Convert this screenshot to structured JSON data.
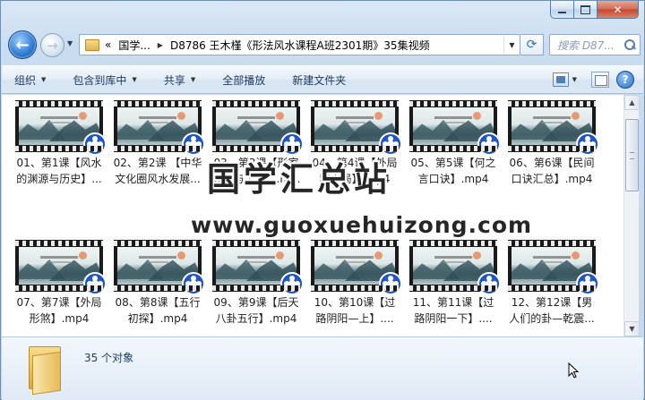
{
  "window": {
    "caption_buttons": [
      "minimize",
      "maximize",
      "close"
    ]
  },
  "address": {
    "overflow": "«",
    "segments": [
      "国学...",
      "D8786 王木槿《形法风水课程A班2301期》35集视频"
    ],
    "search_placeholder": "搜索 D87..."
  },
  "toolbar": {
    "organize": "组织",
    "include_library": "包含到库中",
    "share": "共享",
    "play_all": "全部播放",
    "new_folder": "新建文件夹"
  },
  "files": [
    {
      "line1": "01、第1课【风水",
      "line2": "的渊源与历史】..."
    },
    {
      "line1": "02、第2课 【中华",
      "line2": "文化圈风水发展..."
    },
    {
      "line1": "03、第3课【形家",
      "line2": "理气与工具】.m..."
    },
    {
      "line1": "04、第4课【外局",
      "line2": "和内局】.mp4"
    },
    {
      "line1": "05、第5课【何之",
      "line2": "言口诀】.mp4"
    },
    {
      "line1": "06、第6课【民间",
      "line2": "口诀汇总】.mp4"
    },
    {
      "line1": "07、第7课【外局",
      "line2": "形煞】.mp4"
    },
    {
      "line1": "08、第8课【五行",
      "line2": "初探】.mp4"
    },
    {
      "line1": "09、第9课【后天",
      "line2": "八卦五行】.mp4"
    },
    {
      "line1": "10、第10课【过",
      "line2": "路阴阳—上】...."
    },
    {
      "line1": "11、第11课【过",
      "line2": "路阴阳一下】...."
    },
    {
      "line1": "12、第12课【男",
      "line2": "人们的卦—乾震..."
    }
  ],
  "watermark": {
    "title": "国学汇总站",
    "url": "www.guoxuehuizong.com"
  },
  "status": {
    "count": "35 个对象"
  }
}
